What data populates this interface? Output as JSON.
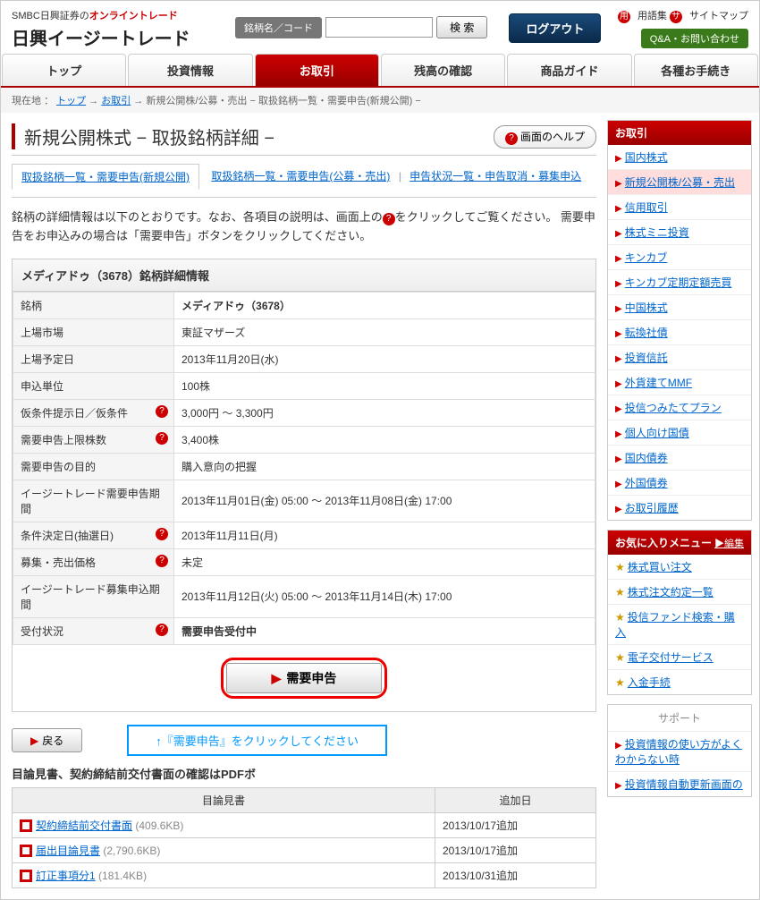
{
  "header": {
    "logo_sub_prefix": "SMBC日興証券の",
    "logo_sub_online": "オンライントレード",
    "logo_main": "日興イージートレード",
    "search_label": "銘柄名／コード",
    "search_btn": "検 索",
    "logout": "ログアウト",
    "yogo": "用語集",
    "sitemap": "サイトマップ",
    "qa": "Q&A・お問い合わせ"
  },
  "nav": {
    "tabs": [
      "トップ",
      "投資情報",
      "お取引",
      "残高の確認",
      "商品ガイド",
      "各種お手続き"
    ],
    "active_index": 2
  },
  "breadcrumb": {
    "label": "現在地 ：",
    "items": [
      "トップ",
      "お取引",
      "新規公開株/公募・売出",
      "取扱銘柄一覧・需要申告(新規公開)"
    ],
    "sep": " → ",
    "tail_sep": " − "
  },
  "page": {
    "title": "新規公開株式 − 取扱銘柄詳細 −",
    "help_btn": "画面のヘルプ"
  },
  "subtabs": {
    "active": "取扱銘柄一覧・需要申告(新規公開)",
    "links": [
      "取扱銘柄一覧・需要申告(公募・売出)",
      "申告状況一覧・申告取消・募集申込"
    ]
  },
  "desc": {
    "p1a": "銘柄の詳細情報は以下のとおりです。なお、各項目の説明は、画面上の",
    "p1b": "をクリックしてご覧ください。 需要申告をお申込みの場合は「需要申告」ボタンをクリックしてください。"
  },
  "detail": {
    "title": "メディアドゥ（3678）銘柄詳細情報",
    "rows": [
      {
        "label": "銘柄",
        "value": "メディアドゥ（3678）",
        "bold": true,
        "help": false
      },
      {
        "label": "上場市場",
        "value": "東証マザーズ",
        "help": false
      },
      {
        "label": "上場予定日",
        "value": "2013年11月20日(水)",
        "help": false
      },
      {
        "label": "申込単位",
        "value": "100株",
        "help": false
      },
      {
        "label": "仮条件提示日／仮条件",
        "value": "3,000円 〜 3,300円",
        "help": true
      },
      {
        "label": "需要申告上限株数",
        "value": "3,400株",
        "help": true
      },
      {
        "label": "需要申告の目的",
        "value": "購入意向の把握",
        "help": false
      },
      {
        "label": "イージートレード需要申告期間",
        "value": "2013年11月01日(金) 05:00 〜 2013年11月08日(金) 17:00",
        "help": false
      },
      {
        "label": "条件決定日(抽選日)",
        "value": "2013年11月11日(月)",
        "help": true
      },
      {
        "label": "募集・売出価格",
        "value": "未定",
        "help": true
      },
      {
        "label": "イージートレード募集申込期間",
        "value": "2013年11月12日(火) 05:00 〜 2013年11月14日(木) 17:00",
        "help": false
      },
      {
        "label": "受付状況",
        "value": "需要申告受付中",
        "bold": true,
        "help": true
      }
    ]
  },
  "actions": {
    "apply": "需要申告",
    "back": "戻る",
    "instruction": "↑『需要申告』をクリックしてください"
  },
  "docs": {
    "heading": "目論見書、契約締結前交付書面の確認はPDFボ",
    "col1": "目論見書",
    "col2": "追加日",
    "rows": [
      {
        "name": "契約締結前交付書面",
        "size": "(409.6KB)",
        "date": "2013/10/17追加"
      },
      {
        "name": "届出目論見書",
        "size": "(2,790.6KB)",
        "date": "2013/10/17追加"
      },
      {
        "name": "訂正事項分1",
        "size": "(181.4KB)",
        "date": "2013/10/31追加"
      }
    ]
  },
  "sidebar": {
    "trading_h": "お取引",
    "trading_items": [
      "国内株式",
      "新規公開株/公募・売出",
      "信用取引",
      "株式ミニ投資",
      "キンカブ",
      "キンカブ定期定額売買",
      "中国株式",
      "転換社債",
      "投資信託",
      "外貨建てMMF",
      "投信つみたてプラン",
      "個人向け国債",
      "国内債券",
      "外国債券",
      "お取引履歴"
    ],
    "trading_active": 1,
    "fav_h": "お気に入りメニュー",
    "fav_edit": "▶編集",
    "fav_items": [
      "株式買い注文",
      "株式注文約定一覧",
      "投信ファンド検索・購入",
      "電子交付サービス",
      "入金手続"
    ],
    "support_h": "サポート",
    "support_items": [
      "投資情報の使い方がよくわからない時",
      "投資情報自動更新画面の"
    ]
  }
}
